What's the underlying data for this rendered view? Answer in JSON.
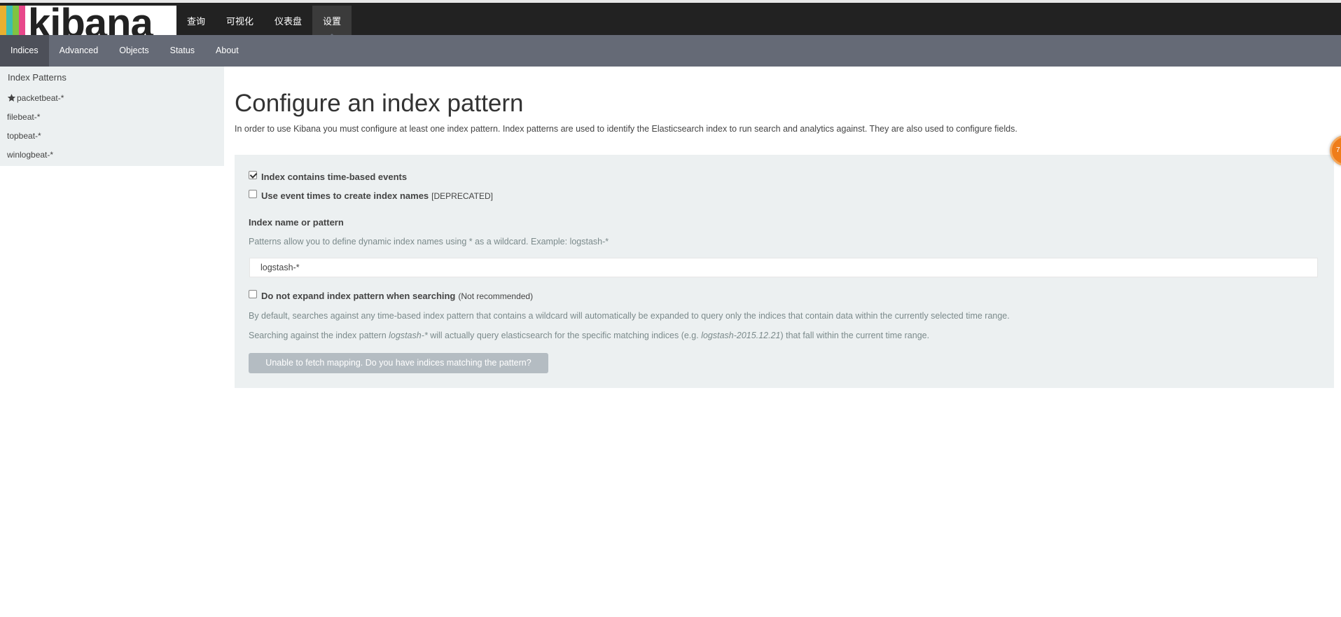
{
  "brand": {
    "name": "kibana",
    "stripe_colors": [
      "#e8b030",
      "#3cbeb1",
      "#80c342",
      "#e8478b"
    ]
  },
  "topnav": {
    "items": [
      {
        "label": "查询",
        "active": false
      },
      {
        "label": "可视化",
        "active": false
      },
      {
        "label": "仪表盘",
        "active": false
      },
      {
        "label": "设置",
        "active": true
      }
    ]
  },
  "subnav": {
    "items": [
      {
        "label": "Indices",
        "active": true
      },
      {
        "label": "Advanced",
        "active": false
      },
      {
        "label": "Objects",
        "active": false
      },
      {
        "label": "Status",
        "active": false
      },
      {
        "label": "About",
        "active": false
      }
    ]
  },
  "sidebar": {
    "heading": "Index Patterns",
    "patterns": [
      {
        "label": "packetbeat-*",
        "default": true,
        "icon": "star-icon"
      },
      {
        "label": "filebeat-*",
        "default": false
      },
      {
        "label": "topbeat-*",
        "default": false
      },
      {
        "label": "winlogbeat-*",
        "default": false
      }
    ]
  },
  "main": {
    "title": "Configure an index pattern",
    "description": "In order to use Kibana you must configure at least one index pattern. Index patterns are used to identify the Elasticsearch index to run search and analytics against. They are also used to configure fields."
  },
  "form": {
    "time_based": {
      "label": "Index contains time-based events",
      "checked": true
    },
    "event_times": {
      "label": "Use event times to create index names",
      "note": "[DEPRECATED]",
      "checked": false
    },
    "pattern_label": "Index name or pattern",
    "pattern_help": "Patterns allow you to define dynamic index names using * as a wildcard. Example: logstash-*",
    "pattern_value": "logstash-*",
    "no_expand": {
      "label": "Do not expand index pattern when searching",
      "note": "(Not recommended)",
      "checked": false
    },
    "expand_help_1": "By default, searches against any time-based index pattern that contains a wildcard will automatically be expanded to query only the indices that contain data within the currently selected time range.",
    "expand_help_2": {
      "prefix": "Searching against the index pattern ",
      "pattern": "logstash-*",
      "middle": " will actually query elasticsearch for the specific matching indices (e.g. ",
      "example": "logstash-2015.12.21",
      "suffix": ") that fall within the current time range."
    },
    "submit_label": "Unable to fetch mapping. Do you have indices matching the pattern?"
  },
  "colors": {
    "topbar": "#222222",
    "subnav": "#656a76",
    "subnav_active": "#4d5059",
    "panel": "#ecf0f1",
    "button_disabled": "#b4bcc2",
    "widget": "#ef7d1a"
  }
}
